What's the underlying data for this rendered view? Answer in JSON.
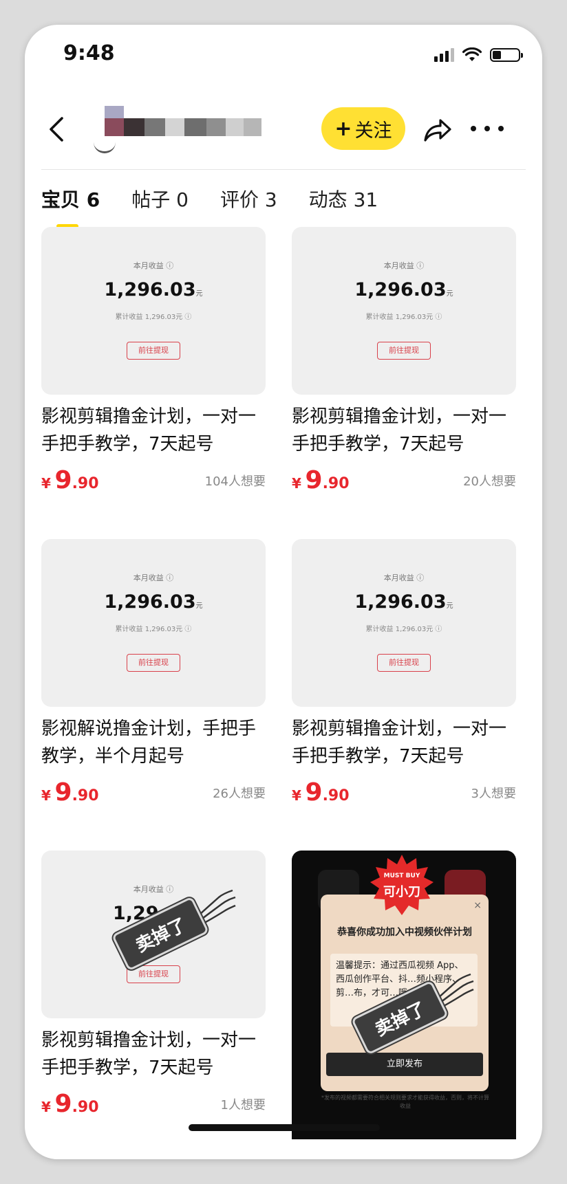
{
  "status": {
    "time": "9:48"
  },
  "header": {
    "follow_plus": "+",
    "follow_label": "关注"
  },
  "tabs": [
    {
      "label": "宝贝 6"
    },
    {
      "label": "帖子 0"
    },
    {
      "label": "评价 3"
    },
    {
      "label": "动态 31"
    }
  ],
  "thumb": {
    "caption": "本月收益 ⓘ",
    "amount": "1,296.03",
    "amount_unit": "元",
    "cumulative": "累计收益 1,296.03元 ⓘ",
    "withdraw": "前往提现"
  },
  "price": {
    "symbol": "¥",
    "int": "9",
    "dec": ".90"
  },
  "products": [
    {
      "title": "影视剪辑撸金计划，一对一手把手教学，7天起号",
      "wants": "104人想要"
    },
    {
      "title": "影视剪辑撸金计划，一对一手把手教学，7天起号",
      "wants": "20人想要"
    },
    {
      "title": "影视解说撸金计划，手把手教学，半个月起号",
      "wants": "26人想要"
    },
    {
      "title": "影视剪辑撸金计划，一对一手把手教学，7天起号",
      "wants": "3人想要"
    },
    {
      "title": "影视剪辑撸金计划，一对一手把手教学，7天起号",
      "wants": "1人想要"
    }
  ],
  "sold_label": "卖掉了",
  "partial_amount": "1,29",
  "dark_card": {
    "burst_top": "MUST BUY",
    "burst_main": "可小刀",
    "modal_title": "恭喜你成功加入中视频伙伴计划",
    "modal_close": "×",
    "modal_body": "温馨提示：通过西瓜视频 App、西瓜创作平台、抖…频小程序、剪…布，才可…哦。",
    "modal_button": "立即发布",
    "footer": "*发布的视频都需要符合相关规则要求才能获得收益，否则，将不计算收益"
  },
  "colors": {
    "accent_yellow": "#ffe033",
    "price_red": "#e8262d",
    "sold_tag": "#3d3d3d"
  }
}
